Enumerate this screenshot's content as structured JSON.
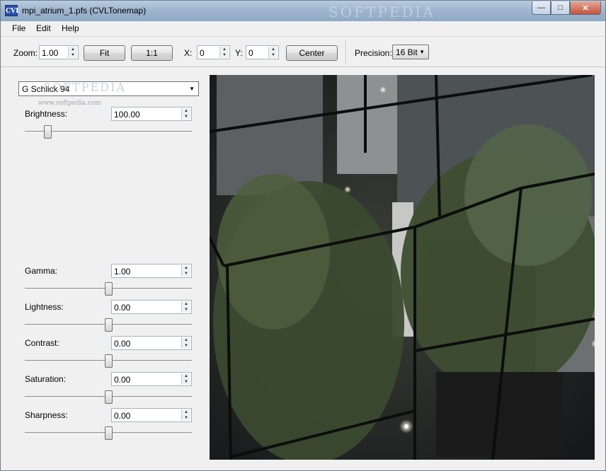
{
  "window": {
    "title": "mpi_atrium_1.pfs (CVLTonemap)",
    "app_icon_text": "CVL"
  },
  "watermark": {
    "top": "SOFTPEDIA",
    "combo": "SOFTPEDIA",
    "small": "www.softpedia.com"
  },
  "menu": [
    "File",
    "Edit",
    "Help"
  ],
  "toolbar": {
    "zoom_label": "Zoom:",
    "zoom_value": "1.00",
    "fit_label": "Fit",
    "one_to_one_label": "1:1",
    "x_label": "X:",
    "x_value": "0",
    "y_label": "Y:",
    "y_value": "0",
    "center_label": "Center",
    "precision_label": "Precision:",
    "precision_value": "16 Bit"
  },
  "panel": {
    "operator": "G Schlick 94",
    "params": [
      {
        "label": "Brightness:",
        "value": "100.00",
        "position": 0.12
      },
      {
        "label": "Gamma:",
        "value": "1.00",
        "position": 0.5
      },
      {
        "label": "Lightness:",
        "value": "0.00",
        "position": 0.5
      },
      {
        "label": "Contrast:",
        "value": "0.00",
        "position": 0.5
      },
      {
        "label": "Saturation:",
        "value": "0.00",
        "position": 0.5
      },
      {
        "label": "Sharpness:",
        "value": "0.00",
        "position": 0.5
      }
    ]
  }
}
